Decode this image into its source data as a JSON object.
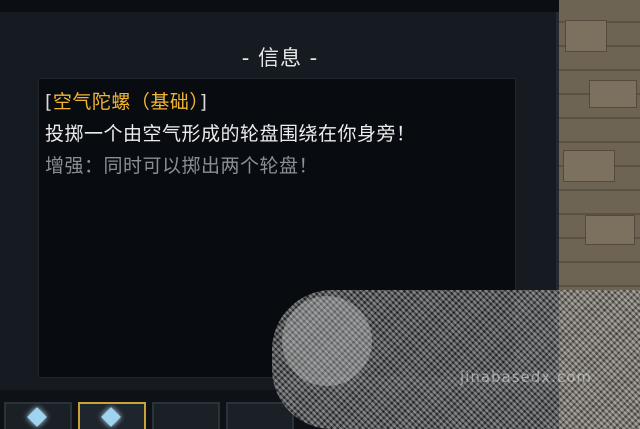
{
  "panel": {
    "title": "- 信息 -"
  },
  "info": {
    "bracket_open": "[",
    "name": "空气陀螺（基础）",
    "bracket_close": "]",
    "description": "投掷一个由空气形成的轮盘围绕在你身旁！",
    "upgrade": "增强：同时可以掷出两个轮盘！"
  },
  "watermark": {
    "text": "jinabasedx.com"
  },
  "colors": {
    "name_color": "#f2b531",
    "text_color": "#ececec",
    "dim_text_color": "#8a8f94",
    "panel_bg": "#151b21",
    "info_bg": "#080b0f",
    "selected_border": "#c9a23a"
  },
  "bottom_slots": [
    {
      "icon": "air-spinner-icon",
      "selected": false
    },
    {
      "icon": "air-spinner-icon",
      "selected": true
    },
    {
      "icon": "empty-slot",
      "selected": false
    },
    {
      "icon": "empty-slot",
      "selected": false
    }
  ]
}
